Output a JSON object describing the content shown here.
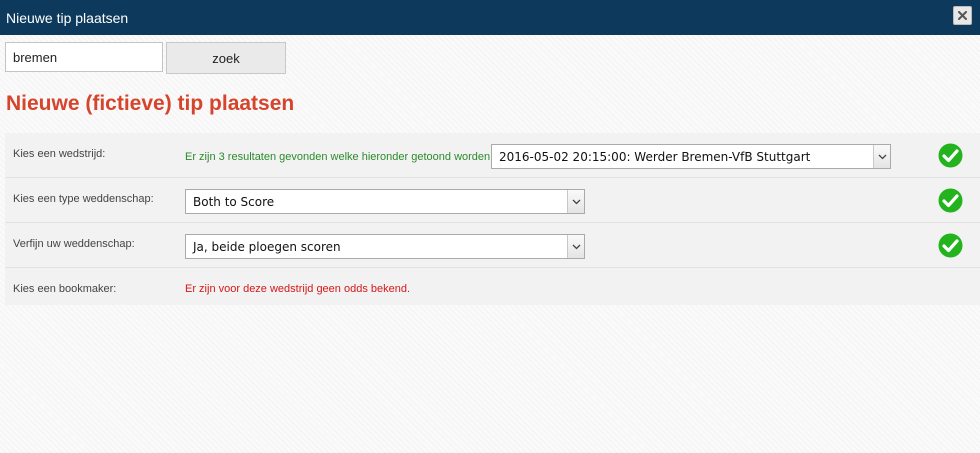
{
  "window": {
    "title": "Nieuwe tip plaatsen"
  },
  "search": {
    "value": "bremen",
    "button_label": "zoek"
  },
  "heading": "Nieuwe (fictieve) tip plaatsen",
  "form": {
    "match": {
      "label": "Kies een wedstrijd:",
      "result_message": "Er zijn 3 resultaten gevonden welke hieronder getoond worden.",
      "selected": "2016-05-02 20:15:00: Werder Bremen-VfB Stuttgart",
      "status_icon": "green-check-icon"
    },
    "bet_type": {
      "label": "Kies een type weddenschap:",
      "selected": "Both to Score",
      "status_icon": "green-check-icon"
    },
    "refine": {
      "label": "Verfijn uw weddenschap:",
      "selected": "Ja, beide ploegen scoren",
      "status_icon": "green-check-icon"
    },
    "bookmaker": {
      "label": "Kies een bookmaker:",
      "error_message": "Er zijn voor deze wedstrijd geen odds bekend."
    }
  },
  "colors": {
    "titlebar": "#0d3a5c",
    "heading": "#d6452b",
    "success_text": "#2c8a2c",
    "error_text": "#d51818",
    "check_green": "#22b31d"
  }
}
